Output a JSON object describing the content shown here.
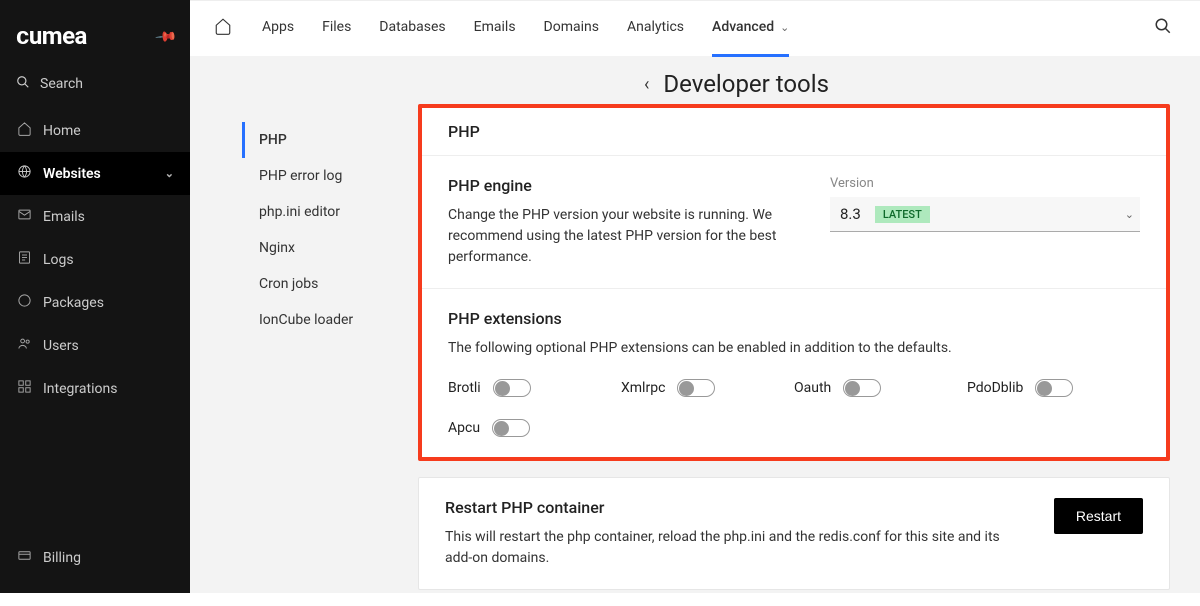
{
  "brand": "ᴄumea",
  "search_label": "Search",
  "sidebar": {
    "items": [
      {
        "label": "Home",
        "icon": "⌂"
      },
      {
        "label": "Websites",
        "icon": "⊕",
        "active": true,
        "expandable": true
      },
      {
        "label": "Emails",
        "icon": "✉"
      },
      {
        "label": "Logs",
        "icon": "▤"
      },
      {
        "label": "Packages",
        "icon": "◯"
      },
      {
        "label": "Users",
        "icon": "⚇"
      },
      {
        "label": "Integrations",
        "icon": "⊞"
      }
    ],
    "bottom": {
      "label": "Billing",
      "icon": "⌨"
    }
  },
  "topnav": {
    "tabs": [
      "Apps",
      "Files",
      "Databases",
      "Emails",
      "Domains",
      "Analytics",
      "Advanced"
    ],
    "active": "Advanced"
  },
  "page": {
    "title": "Developer tools",
    "subnav": [
      "PHP",
      "PHP error log",
      "php.ini editor",
      "Nginx",
      "Cron jobs",
      "IonCube loader"
    ],
    "subnav_active": "PHP"
  },
  "php_card": {
    "title": "PHP",
    "engine": {
      "heading": "PHP engine",
      "desc": "Change the PHP version your website is running. We recommend using the latest PHP version for the best performance.",
      "version_label": "Version",
      "version": "8.3",
      "badge": "LATEST"
    },
    "extensions": {
      "heading": "PHP extensions",
      "desc": "The following optional PHP extensions can be enabled in addition to the defaults.",
      "list": [
        "Brotli",
        "Xmlrpc",
        "Oauth",
        "PdoDblib",
        "Apcu"
      ]
    }
  },
  "restart": {
    "heading": "Restart PHP container",
    "desc": "This will restart the php container, reload the php.ini and the redis.conf for this site and its add-on domains.",
    "button": "Restart"
  }
}
